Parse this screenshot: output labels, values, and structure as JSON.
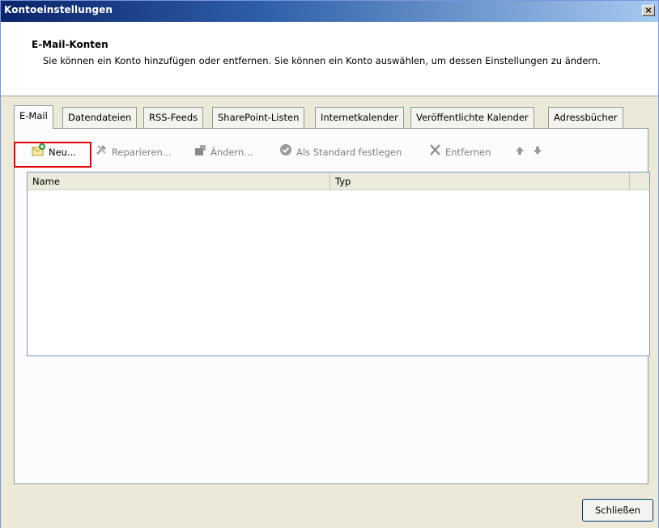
{
  "window": {
    "title": "Kontoeinstellungen",
    "close_glyph": "×"
  },
  "header": {
    "title": "E-Mail-Konten",
    "description": "Sie können ein Konto hinzufügen oder entfernen. Sie können ein Konto auswählen, um dessen Einstellungen zu ändern."
  },
  "tabs": [
    {
      "label": "E-Mail",
      "active": true
    },
    {
      "label": "Datendateien",
      "active": false
    },
    {
      "label": "RSS-Feeds",
      "active": false
    },
    {
      "label": "SharePoint-Listen",
      "active": false
    },
    {
      "label": "Internetkalender",
      "active": false
    },
    {
      "label": "Veröffentlichte Kalender",
      "active": false
    },
    {
      "label": "Adressbücher",
      "active": false
    }
  ],
  "toolbar": {
    "new": {
      "label": "Neu...",
      "enabled": true,
      "icon": "new-account-icon"
    },
    "repair": {
      "label": "Reparieren...",
      "enabled": false,
      "icon": "repair-tools-icon"
    },
    "change": {
      "label": "Ändern...",
      "enabled": false,
      "icon": "change-icon"
    },
    "set_default": {
      "label": "Als Standard festlegen",
      "enabled": false,
      "icon": "checkmark-circle-icon"
    },
    "remove": {
      "label": "Entfernen",
      "enabled": false,
      "icon": "remove-x-icon"
    },
    "move_up": {
      "icon": "arrow-up-icon",
      "enabled": false
    },
    "move_down": {
      "icon": "arrow-down-icon",
      "enabled": false
    },
    "highlight_color": "#e0000c"
  },
  "list": {
    "columns": [
      "Name",
      "Typ"
    ],
    "rows": []
  },
  "footer": {
    "close_label": "Schließen"
  }
}
